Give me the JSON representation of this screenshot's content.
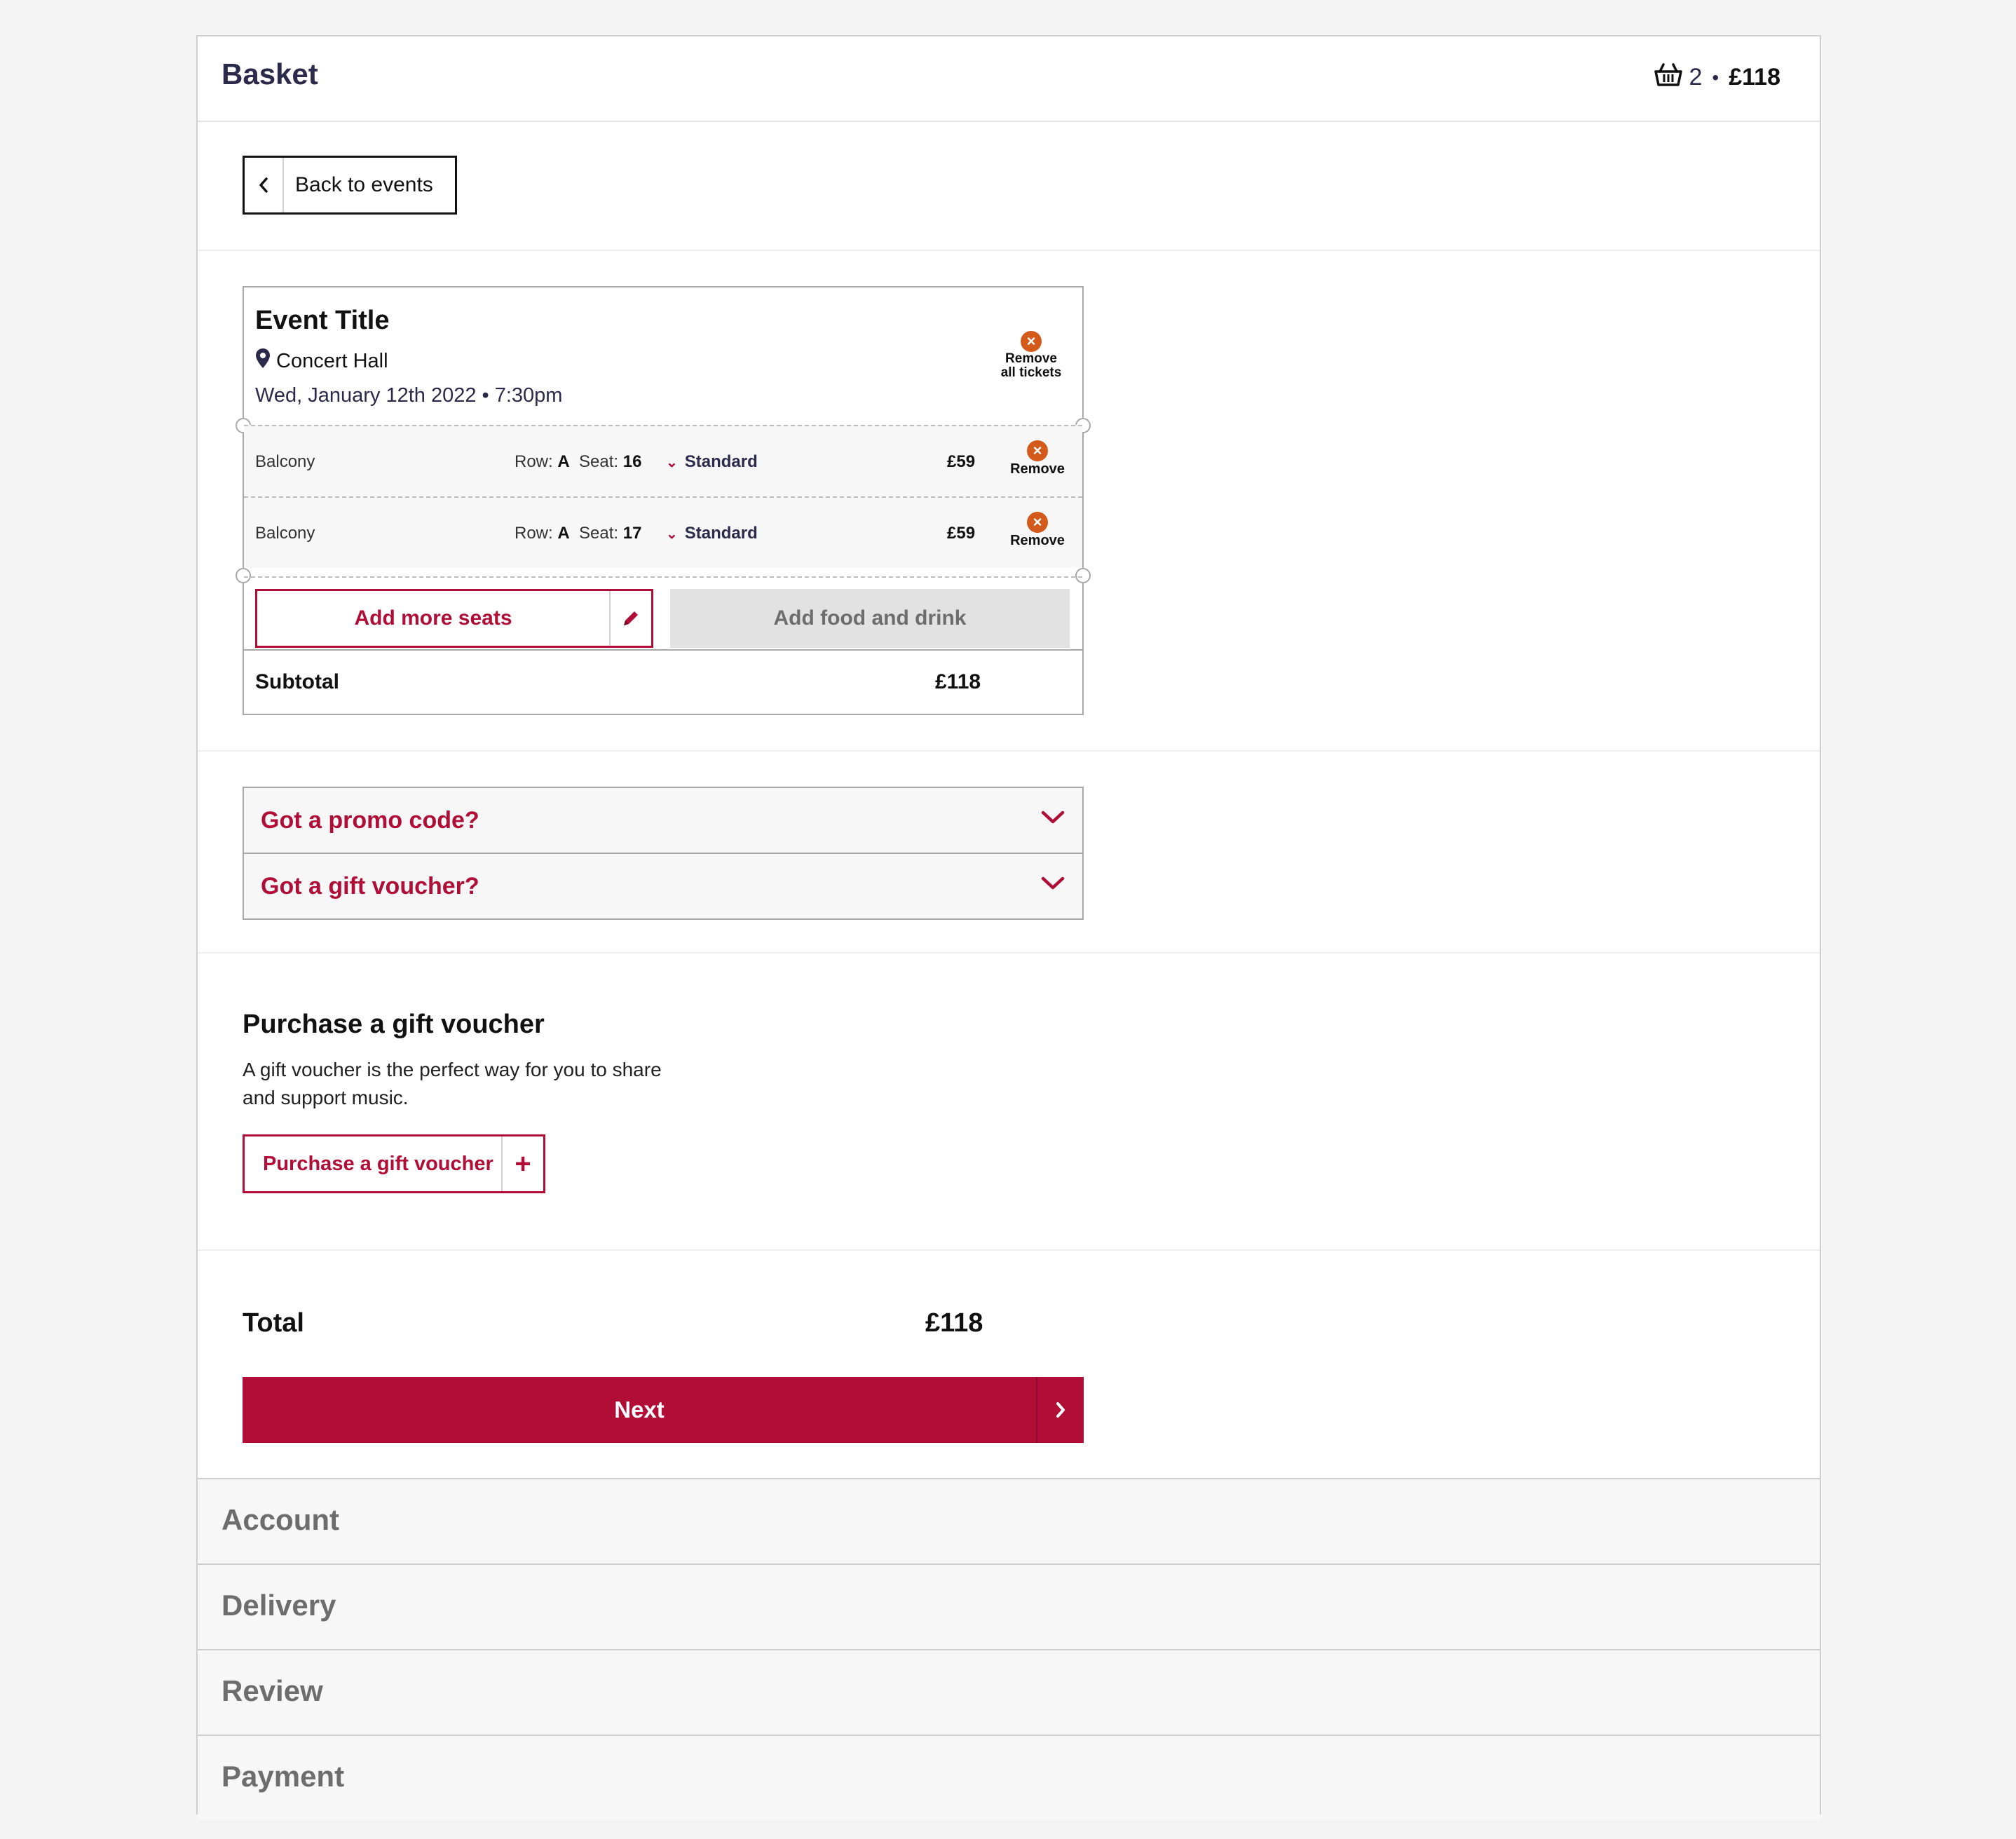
{
  "header": {
    "title": "Basket",
    "ticket_count": "2",
    "separator": "•",
    "total": "£118"
  },
  "back_button": {
    "label": "Back to events"
  },
  "event": {
    "title": "Event Title",
    "venue": "Concert Hall",
    "datetime": "Wed, January 12th 2022 • 7:30pm",
    "remove_all_line1": "Remove",
    "remove_all_line2": "all tickets",
    "seats": [
      {
        "area": "Balcony",
        "row_label": "Row:",
        "row": "A",
        "seat_label": "Seat:",
        "seat": "16",
        "price_type": "Standard",
        "price": "£59",
        "remove": "Remove"
      },
      {
        "area": "Balcony",
        "row_label": "Row:",
        "row": "A",
        "seat_label": "Seat:",
        "seat": "17",
        "price_type": "Standard",
        "price": "£59",
        "remove": "Remove"
      }
    ],
    "add_seats_label": "Add more seats",
    "add_food_label": "Add food and drink",
    "subtotal_label": "Subtotal",
    "subtotal_value": "£118"
  },
  "codes": {
    "promo_label": "Got a promo code?",
    "voucher_label": "Got a gift voucher?"
  },
  "gift_voucher": {
    "title": "Purchase a gift voucher",
    "description": "A gift voucher is the perfect way for you to share and support music.",
    "button_label": "Purchase a gift voucher"
  },
  "summary": {
    "total_label": "Total",
    "total_value": "£118",
    "next_label": "Next"
  },
  "steps": [
    "Account",
    "Delivery",
    "Review",
    "Payment"
  ],
  "colors": {
    "accent": "#b00d37",
    "remove": "#d45a1c",
    "navy": "#2b2a4a"
  },
  "icons": {
    "basket": "basket-icon",
    "back": "chevron-left-icon",
    "pin": "map-pin-icon",
    "remove": "close-circle-icon",
    "edit": "pencil-icon",
    "expand": "chevron-down-icon",
    "add": "plus-icon",
    "next": "chevron-right-icon"
  }
}
